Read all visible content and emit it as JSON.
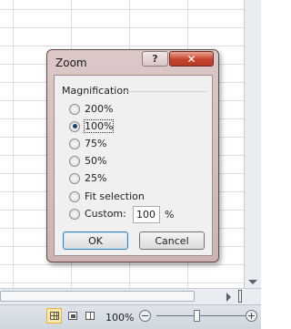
{
  "dialog": {
    "title": "Zoom",
    "help_label": "?",
    "close_label": "✕",
    "group_label": "Magnification",
    "options": [
      {
        "label": "200%",
        "checked": false
      },
      {
        "label": "100%",
        "checked": true
      },
      {
        "label": "75%",
        "checked": false
      },
      {
        "label": "50%",
        "checked": false
      },
      {
        "label": "25%",
        "checked": false
      },
      {
        "label": "Fit selection",
        "checked": false
      },
      {
        "label": "Custom:",
        "checked": false
      }
    ],
    "custom_value": "100",
    "percent_sign": "%",
    "ok_label": "OK",
    "cancel_label": "Cancel"
  },
  "statusbar": {
    "zoom_level": "100%",
    "zoom_out": "−",
    "zoom_in": "+"
  },
  "colors": {
    "dialog_frame": "#cdb4b3",
    "close_button": "#c7432f",
    "client_background": "#f0f0f0"
  }
}
